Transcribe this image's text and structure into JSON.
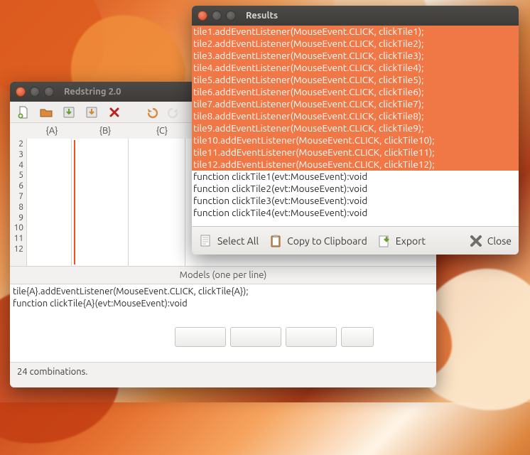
{
  "main": {
    "title": "Redstring 2.0",
    "columns": {
      "a": "{A}",
      "b": "{B}",
      "c": "{C}"
    },
    "line_numbers": [
      "2",
      "3",
      "4",
      "5",
      "6",
      "7",
      "8",
      "9",
      "10",
      "11",
      "12"
    ],
    "models_header": "Models (one per line)",
    "models": [
      "tile{A}.addEventListener(MouseEvent.CLICK, clickTile{A});",
      "function clickTile{A}(evt:MouseEvent):void"
    ],
    "status": "24 combinations."
  },
  "results": {
    "title": "Results",
    "selected": [
      "tile1.addEventListener(MouseEvent.CLICK, clickTile1);",
      "tile2.addEventListener(MouseEvent.CLICK, clickTile2);",
      "tile3.addEventListener(MouseEvent.CLICK, clickTile3);",
      "tile4.addEventListener(MouseEvent.CLICK, clickTile4);",
      "tile5.addEventListener(MouseEvent.CLICK, clickTile5);",
      "tile6.addEventListener(MouseEvent.CLICK, clickTile6);",
      "tile7.addEventListener(MouseEvent.CLICK, clickTile7);",
      "tile8.addEventListener(MouseEvent.CLICK, clickTile8);",
      "tile9.addEventListener(MouseEvent.CLICK, clickTile9);",
      "tile10.addEventListener(MouseEvent.CLICK, clickTile10);",
      "tile11.addEventListener(MouseEvent.CLICK, clickTile11);",
      "tile12.addEventListener(MouseEvent.CLICK, clickTile12);"
    ],
    "unselected": [
      "function clickTile1(evt:MouseEvent):void",
      "function clickTile2(evt:MouseEvent):void",
      "function clickTile3(evt:MouseEvent):void",
      "function clickTile4(evt:MouseEvent):void"
    ],
    "buttons": {
      "select_all": "Select All",
      "copy": "Copy to Clipboard",
      "export": "Export",
      "close": "Close"
    }
  },
  "icons": {
    "new": "new-file-icon",
    "open": "open-file-icon",
    "save": "save-icon",
    "save_as": "save-as-icon",
    "delete": "delete-icon",
    "undo": "undo-icon",
    "redo": "redo-icon",
    "cut": "cut-icon",
    "select_all": "select-all-icon",
    "copy": "clipboard-icon",
    "export": "export-icon",
    "close": "close-x-icon"
  }
}
